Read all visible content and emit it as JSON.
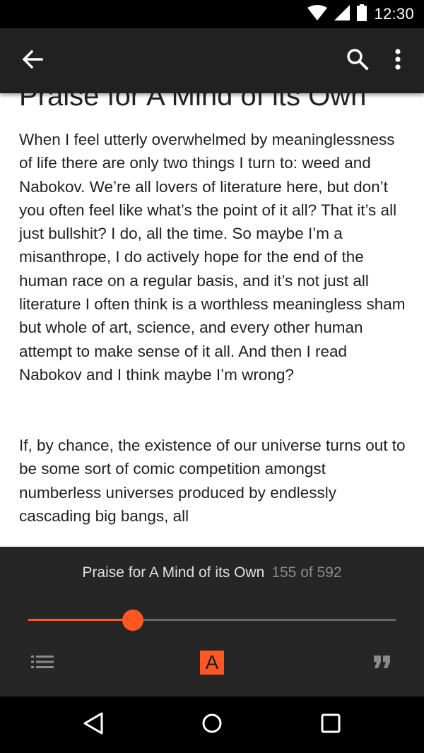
{
  "status_bar": {
    "time": "12:30",
    "icons": [
      "wifi-icon",
      "cell-signal-icon",
      "battery-icon"
    ]
  },
  "app_bar": {
    "icons": [
      "back-arrow-icon",
      "search-icon",
      "more-vert-icon"
    ]
  },
  "content": {
    "chapter_title": "Praise for A Mind of its Own",
    "paragraphs": [
      "When I feel utterly overwhelmed by meaninglessness of life there are only two things I turn to: weed and Nabokov. We’re all lovers of literature here, but don’t you often feel like what’s the point of it all? That it’s all just bullshit? I do, all the time. So maybe I’m a misanthrope, I do actively hope for the end of the human race on a regular basis, and it’s not just all literature I often think is a worthless meaningless sham but whole of art, science, and every other human attempt to make sense of it all. And then I read Nabokov and I think maybe I’m wrong?",
      "If, by chance, the existence of our universe turns out to be some sort of comic competition amongst numberless universes produced by endlessly cascading big bangs, all"
    ]
  },
  "reader_panel": {
    "chapter_name": "Praise for A Mind of its Own",
    "page_counter": "155 of 592",
    "progress": 0.285,
    "font_button_label": "A",
    "icons": [
      "table-of-contents-icon",
      "font-settings-icon",
      "quote-icon"
    ]
  },
  "nav_bar": {
    "icons": [
      "nav-back-icon",
      "nav-home-icon",
      "nav-recents-icon"
    ]
  },
  "colors": {
    "accent": "#ff5722",
    "app_bar": "#212121",
    "panel": "#262626",
    "system_bars": "#000000"
  }
}
